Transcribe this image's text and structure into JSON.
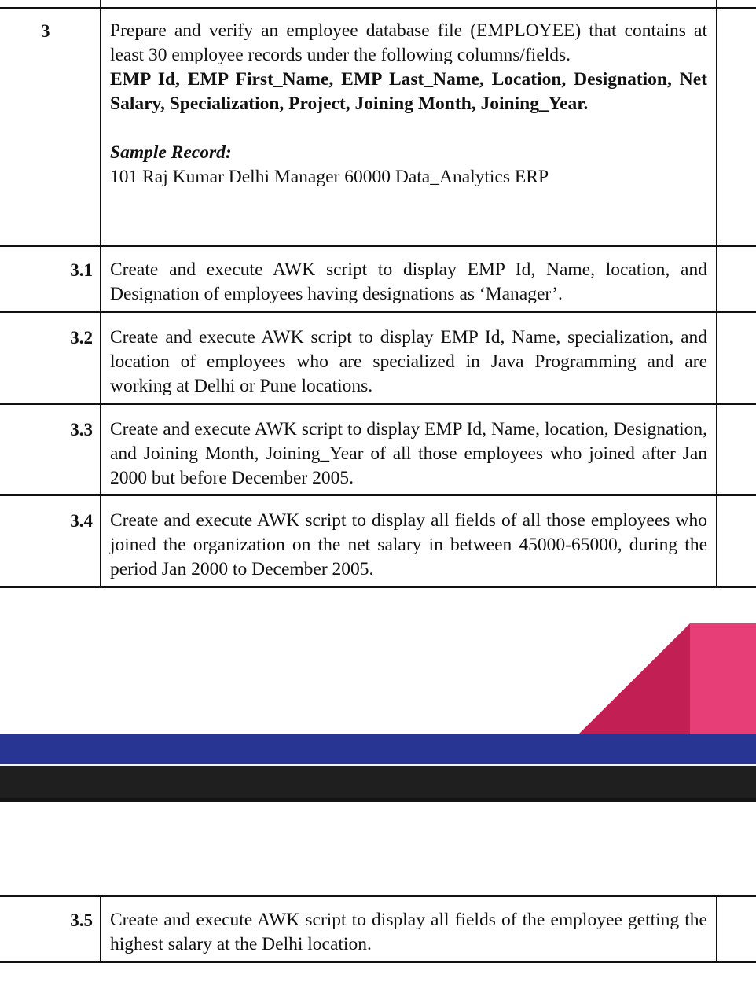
{
  "table": {
    "rows": [
      {
        "num": "3",
        "lines": [
          "Prepare and verify an employee database file (EMPLOYEE) that contains at least 30 employee records under the following columns/fields."
        ],
        "fields_bold": "EMP Id, EMP First_Name, EMP Last_Name, Location, Designation, Net Salary, Specialization, Project, Joining Month, Joining_Year.",
        "sample_label": "Sample Record:",
        "sample_value": "101 Raj Kumar Delhi Manager 60000 Data_Analytics ERP"
      },
      {
        "num": "3.1",
        "text": "Create and execute AWK script to display EMP Id, Name, location, and Designation of employees having designations as ‘Manager’."
      },
      {
        "num": "3.2",
        "text": "Create and execute AWK script to display EMP Id, Name, specialization, and location of employees who are specialized in Java Programming and are working at Delhi or Pune locations."
      },
      {
        "num": "3.3",
        "text": "Create and execute AWK script to display EMP Id, Name, location, Designation, and Joining Month, Joining_Year of all those employees who joined after Jan 2000 but before December 2005."
      },
      {
        "num": "3.4",
        "text": "Create and execute AWK script to display all fields of all those employees who joined the organization on the net salary in between 45000-65000, during the period Jan 2000 to December 2005."
      },
      {
        "num": "3.5",
        "text": "Create and execute AWK script to display all fields of the employee getting the highest salary at the Delhi location."
      }
    ]
  },
  "colors": {
    "band_blue": "#283593",
    "band_dark": "#1f1f1f",
    "deco_pink_dark": "#c21f55",
    "deco_pink_light": "#e83e78"
  }
}
